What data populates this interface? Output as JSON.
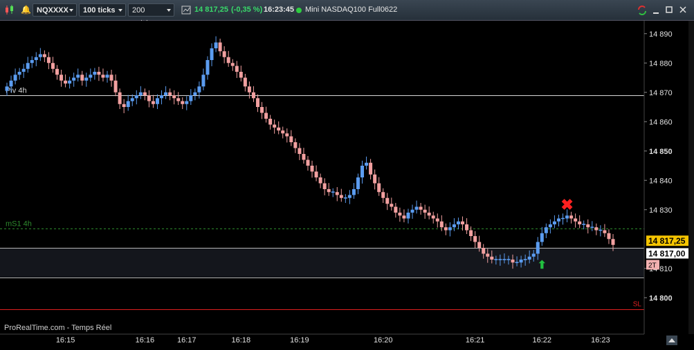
{
  "toolbar": {
    "symbol": "NQXXXX",
    "period": "100 ticks",
    "units": "200 unités",
    "last_price": "14 817,25",
    "change": "(-0,35 %)",
    "time": "16:23:45",
    "instrument": "Mini NASDAQ100 Full0622",
    "colors": {
      "price": "#39d96a",
      "accent": "#3b8cff"
    }
  },
  "chart_data": {
    "type": "candlestick",
    "title": "",
    "xlabel": "",
    "ylabel": "",
    "ylim": [
      14789,
      14893
    ],
    "yticks": [
      14800,
      14810,
      14820,
      14830,
      14840,
      14850,
      14860,
      14870,
      14880,
      14890
    ],
    "ytick_labels": [
      "14 800",
      "14 810",
      "",
      "14 830",
      "14 840",
      "14 850",
      "14 860",
      "14 870",
      "14 880",
      "14 890"
    ],
    "xticks": [
      {
        "label": "16:15",
        "bar": 14
      },
      {
        "label": "16:16",
        "bar": 33
      },
      {
        "label": "16:17",
        "bar": 43
      },
      {
        "label": "16:18",
        "bar": 56
      },
      {
        "label": "16:19",
        "bar": 70
      },
      {
        "label": "16:20",
        "bar": 90
      },
      {
        "label": "16:21",
        "bar": 112
      },
      {
        "label": "16:22",
        "bar": 128
      },
      {
        "label": "16:23",
        "bar": 142
      }
    ],
    "closes": [
      14872,
      14874,
      14876,
      14877,
      14878,
      14880,
      14881,
      14882,
      14883,
      14882,
      14880,
      14878,
      14876,
      14874,
      14873,
      14874,
      14875,
      14876,
      14874,
      14875,
      14876,
      14877,
      14876,
      14875,
      14876,
      14874,
      14870,
      14866,
      14865,
      14867,
      14868,
      14869,
      14870,
      14869,
      14867,
      14866,
      14868,
      14869,
      14870,
      14869,
      14868,
      14867,
      14866,
      14867,
      14869,
      14870,
      14872,
      14876,
      14881,
      14885,
      14887,
      14884,
      14882,
      14880,
      14879,
      14877,
      14875,
      14872,
      14870,
      14868,
      14865,
      14863,
      14861,
      14859,
      14858,
      14857,
      14856,
      14855,
      14853,
      14851,
      14849,
      14847,
      14845,
      14843,
      14841,
      14839,
      14837,
      14836,
      14836,
      14835,
      14834,
      14834,
      14835,
      14837,
      14841,
      14845,
      14846,
      14842,
      14839,
      14836,
      14834,
      14832,
      14831,
      14829,
      14828,
      14827,
      14829,
      14830,
      14831,
      14830,
      14829,
      14828,
      14827,
      14826,
      14824,
      14823,
      14824,
      14825,
      14826,
      14825,
      14823,
      14821,
      14819,
      14817,
      14815,
      14814,
      14813,
      14813,
      14813,
      14813,
      14813,
      14812,
      14812,
      14813,
      14813,
      14814,
      14815,
      14819,
      14822,
      14824,
      14825,
      14826,
      14827,
      14827,
      14828,
      14827,
      14826,
      14825,
      14825,
      14824,
      14824,
      14823,
      14823,
      14822,
      14820,
      14818
    ],
    "colors": {
      "up": "#5b9cf0",
      "down": "#f2a0a0"
    },
    "levels": [
      {
        "label": "Piv 4h",
        "value": 14869,
        "color": "#d8d8d8",
        "style": "solid"
      },
      {
        "label": "mS1 4h",
        "value": 14823.5,
        "color": "#2e8b2e",
        "style": "dashed"
      },
      {
        "label": "",
        "value": 14817,
        "color": "#b8b8b8",
        "style": "solid"
      },
      {
        "label": "",
        "value": 14807,
        "color": "#b8b8b8",
        "style": "solid"
      },
      {
        "label": "SL",
        "value": 14796,
        "color": "#e02020",
        "style": "solid"
      }
    ],
    "price_tags": [
      {
        "label": "14 817,25",
        "value": 14819.3,
        "bg": "#f5c400",
        "fg": "#000"
      },
      {
        "label": "14 817,00",
        "value": 14815,
        "bg": "#ffffff",
        "fg": "#000"
      }
    ],
    "order_tag": {
      "label": "2T",
      "value": 14811
    },
    "markers": [
      {
        "type": "sell",
        "symbol": "✖",
        "bar": 134,
        "value": 14830
      },
      {
        "type": "buy",
        "symbol": "⬆",
        "bar": 128,
        "value": 14810
      }
    ],
    "footer": "ProRealTime.com - Temps Réel"
  }
}
